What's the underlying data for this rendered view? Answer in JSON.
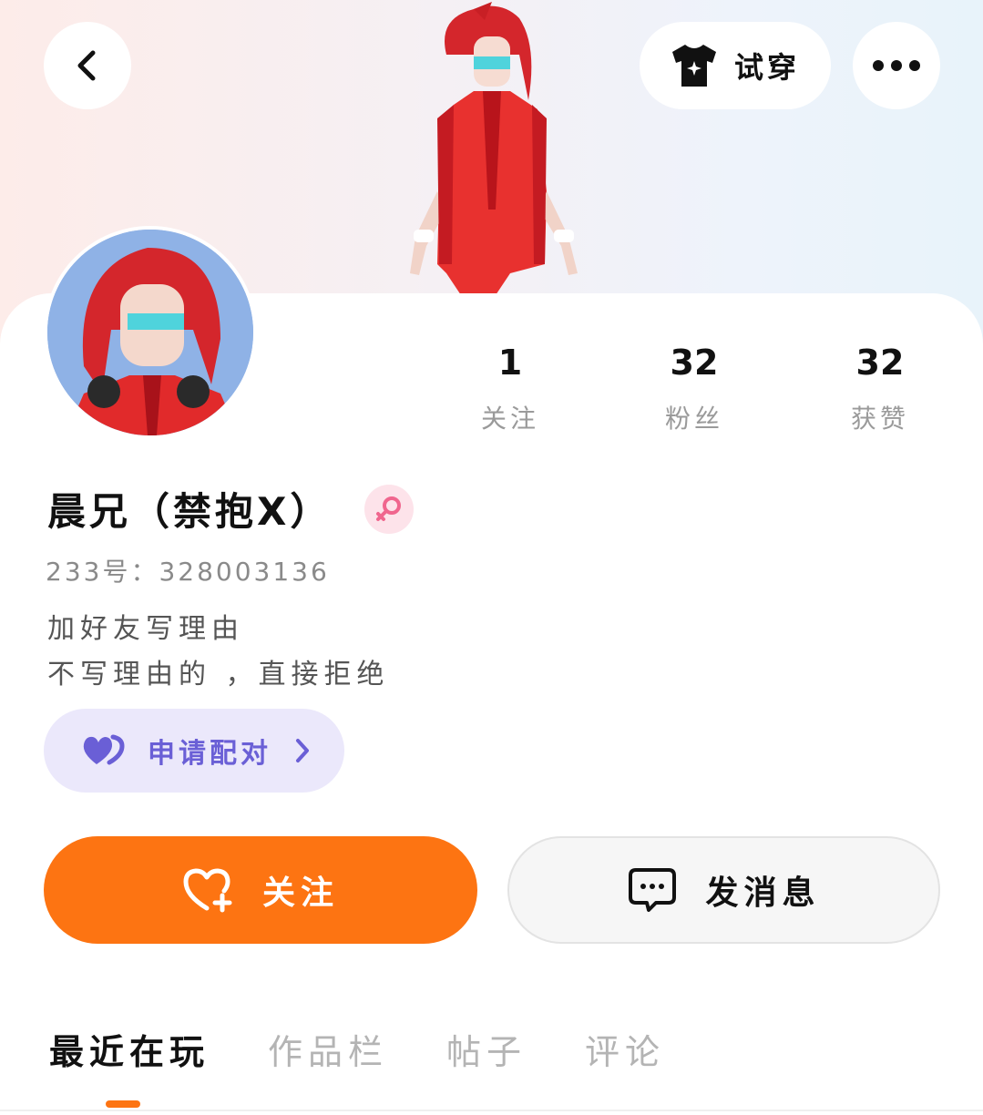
{
  "header": {
    "try_on_label": "试穿",
    "back_icon": "chevron-left-icon",
    "more_icon": "more-dots-icon",
    "try_on_icon": "tshirt-icon"
  },
  "profile": {
    "nickname": "晨兄（禁抱X）",
    "gender": "female",
    "id_line": "233号：328003136",
    "bio_line1": "加好友写理由",
    "bio_line2": "不写理由的 ，直接拒绝"
  },
  "stats": [
    {
      "value": "1",
      "label": "关注"
    },
    {
      "value": "32",
      "label": "粉丝"
    },
    {
      "value": "32",
      "label": "获赞"
    }
  ],
  "pair_button": {
    "label": "申请配对"
  },
  "actions": {
    "follow_label": "关注",
    "message_label": "发消息"
  },
  "tabs": [
    {
      "label": "最近在玩",
      "active": true
    },
    {
      "label": "作品栏",
      "active": false
    },
    {
      "label": "帖子",
      "active": false
    },
    {
      "label": "评论",
      "active": false
    }
  ],
  "colors": {
    "accent": "#fd7412",
    "pair_bg": "#ebe8fb",
    "pair_text": "#6a5fd6",
    "gender_badge_bg": "#fde3ea",
    "gender_icon": "#f0668e"
  }
}
